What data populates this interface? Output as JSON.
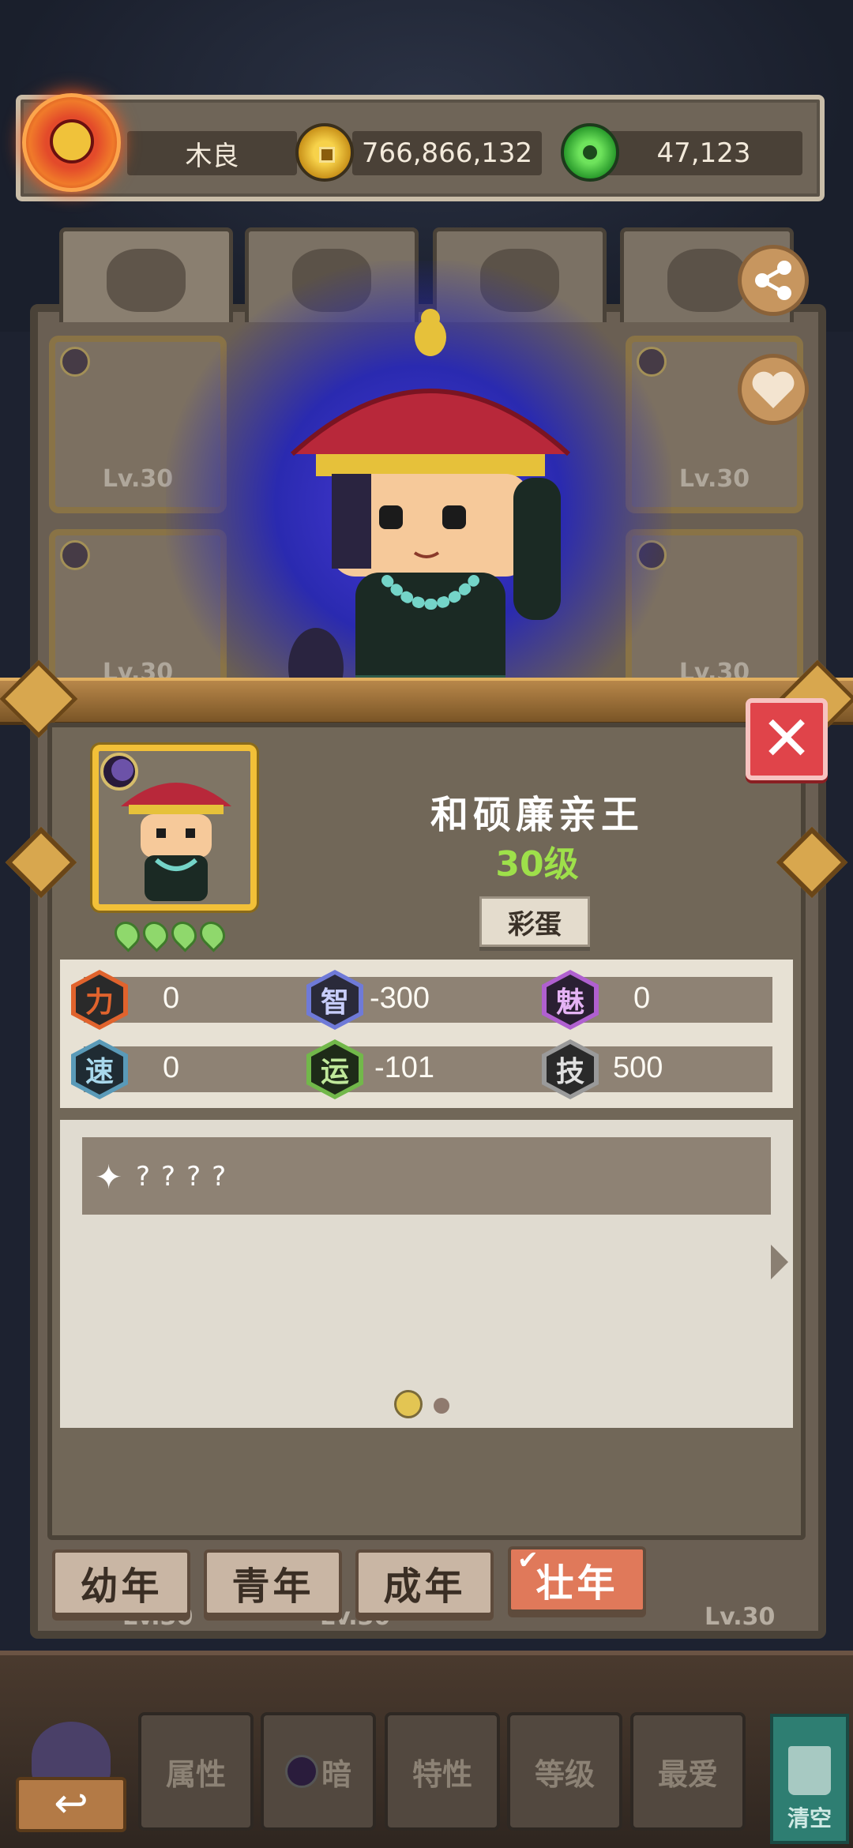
{
  "header": {
    "player_name": "木良",
    "gold_amount": "766,866,132",
    "jade_amount": "47,123"
  },
  "album": {
    "card_levels": [
      "Lv.30",
      "Lv.30",
      "Lv.30",
      "Lv.30",
      "Lv.30",
      "Lv.30",
      "Lv.30"
    ]
  },
  "character": {
    "name": "和硕廉亲王",
    "level_text": "30级",
    "easter_egg_label": "彩蛋",
    "stage_count": 4,
    "close_symbol": "✕"
  },
  "stats": [
    {
      "label": "力",
      "value": "0",
      "color": "#e0632d",
      "inner": "#2a2a2a",
      "fg": "#e0632d"
    },
    {
      "label": "智",
      "value": "-300",
      "color": "#6f7ad8",
      "inner": "#2a2a3a",
      "fg": "#c8cdfa"
    },
    {
      "label": "魅",
      "value": "0",
      "color": "#b060d0",
      "inner": "#2a1f33",
      "fg": "#e5b3f5"
    },
    {
      "label": "速",
      "value": "0",
      "color": "#5a9ab8",
      "inner": "#1f2b33",
      "fg": "#a8d8ec"
    },
    {
      "label": "运",
      "value": "-101",
      "color": "#72b84a",
      "inner": "#1e2b18",
      "fg": "#bfe89a"
    },
    {
      "label": "技",
      "value": "500",
      "color": "#9a9a9a",
      "inner": "#2a2a2a",
      "fg": "#e0e0e0"
    }
  ],
  "ability": {
    "sparkle_icon": "✦",
    "text": "????"
  },
  "life_stage_tabs": {
    "youth": "幼年",
    "young": "青年",
    "adult": "成年",
    "prime": "壮年",
    "selected": "壮年",
    "check_mark": "✔"
  },
  "toolbar": {
    "back_symbol": "↩",
    "attr": "属性",
    "dark": "暗",
    "trait": "特性",
    "level": "等级",
    "favorite": "最爱",
    "clear": "清空"
  }
}
